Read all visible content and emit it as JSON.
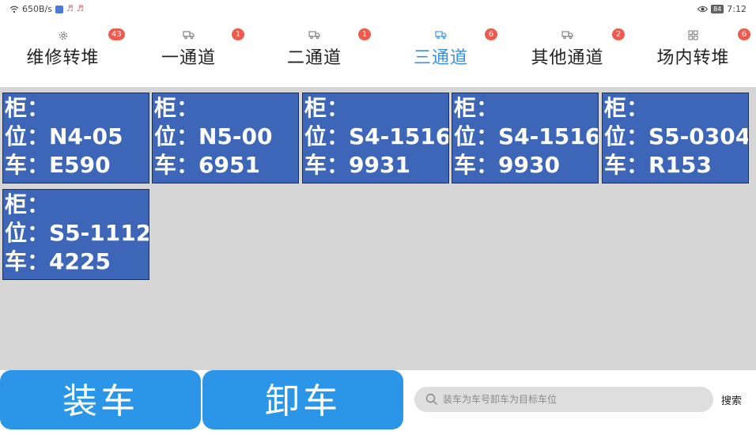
{
  "status_bar": {
    "net_speed": "650B/s",
    "battery": "84",
    "time": "7:12"
  },
  "tabs": [
    {
      "label": "维修转堆",
      "badge": "43",
      "icon": "gear-icon",
      "active": false
    },
    {
      "label": "一通道",
      "badge": "1",
      "icon": "truck-icon",
      "active": false
    },
    {
      "label": "二通道",
      "badge": "1",
      "icon": "truck-icon",
      "active": false
    },
    {
      "label": "三通道",
      "badge": "6",
      "icon": "truck-icon",
      "active": true
    },
    {
      "label": "其他通道",
      "badge": "2",
      "icon": "truck-icon",
      "active": false
    },
    {
      "label": "场内转堆",
      "badge": "6",
      "icon": "grid-icon",
      "active": false
    }
  ],
  "cards": [
    {
      "gui": "柜：",
      "wei": "位：N4-05",
      "che": "车：E590"
    },
    {
      "gui": "柜：",
      "wei": "位：N5-00",
      "che": "车：6951"
    },
    {
      "gui": "柜：",
      "wei": "位：S4-1516",
      "che": "车：9931"
    },
    {
      "gui": "柜：",
      "wei": "位：S4-1516",
      "che": "车：9930"
    },
    {
      "gui": "柜：",
      "wei": "位：S5-0304",
      "che": "车：R153"
    },
    {
      "gui": "柜：",
      "wei": "位：S5-1112",
      "che": "车：4225"
    }
  ],
  "actions": {
    "load_label": "装车",
    "unload_label": "卸车"
  },
  "search": {
    "placeholder": "装车为车号卸车为目标车位",
    "button_label": "搜索"
  },
  "colors": {
    "card_bg": "#3d66b8",
    "action_bg": "#2b96e8",
    "active_tab": "#3a8fe0",
    "badge": "#ee5b4c"
  }
}
